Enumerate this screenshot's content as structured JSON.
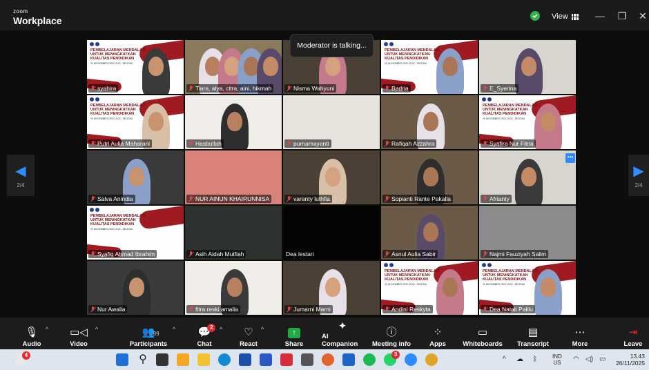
{
  "app": {
    "brand_small": "zoom",
    "brand": "Workplace"
  },
  "titlebar": {
    "view_label": "View",
    "minimize": "—",
    "restore": "❐",
    "close": "✕"
  },
  "toast": "Moderator is talking...",
  "pager": {
    "left": "2/4",
    "right": "2/4"
  },
  "slide": {
    "title": "PEMBELAJARAN MENDALAM UNTUK MENINGKATKAN KUALITAS PENDIDIKAN",
    "date": "20 NOVEMBER 2025 13.00 - SELESAI"
  },
  "participants": [
    {
      "name": "syahira",
      "muted": true,
      "kind": "slide-person"
    },
    {
      "name": "Tiara, alya, citra, aini, hikmah",
      "muted": true,
      "kind": "group"
    },
    {
      "name": "Nisma Wahyuni",
      "muted": true,
      "kind": "person"
    },
    {
      "name": "Badria",
      "muted": true,
      "kind": "slide-person"
    },
    {
      "name": "E_Syerina",
      "muted": true,
      "kind": "person"
    },
    {
      "name": "Putri Aulia Maharani",
      "muted": true,
      "kind": "slide-person"
    },
    {
      "name": "Hasbullah",
      "muted": true,
      "kind": "person"
    },
    {
      "name": "purnamayanti",
      "muted": true,
      "kind": "wall"
    },
    {
      "name": "Rafiqah Azzahra",
      "muted": true,
      "kind": "person"
    },
    {
      "name": "Syafira Nur Fitria",
      "muted": true,
      "kind": "slide-person"
    },
    {
      "name": "Salva Anindia",
      "muted": true,
      "kind": "person"
    },
    {
      "name": "NUR AINUN KHAIRUNNISA",
      "muted": true,
      "kind": "pink"
    },
    {
      "name": "varanty luthfia",
      "muted": true,
      "kind": "person-big"
    },
    {
      "name": "Sopianti Rante Pakalla",
      "muted": true,
      "kind": "person"
    },
    {
      "name": "Afrianty",
      "muted": true,
      "kind": "person"
    },
    {
      "name": "Syafiq Ahmad Ibrahim",
      "muted": true,
      "kind": "slide"
    },
    {
      "name": "Asih Aidah Mutfiah",
      "muted": true,
      "kind": "dark"
    },
    {
      "name": "Dea lestari",
      "muted": false,
      "kind": "black"
    },
    {
      "name": "Asnul Aulia Sabir",
      "muted": true,
      "kind": "person"
    },
    {
      "name": "Najmi Fauziyah Salim",
      "muted": true,
      "kind": "grey"
    },
    {
      "name": "Nur Awalia",
      "muted": true,
      "kind": "person"
    },
    {
      "name": "fitra reski amalia",
      "muted": true,
      "kind": "person"
    },
    {
      "name": "Jumarni Marni",
      "muted": true,
      "kind": "person"
    },
    {
      "name": "Andini Reskyta",
      "muted": true,
      "kind": "slide-person"
    },
    {
      "name": "Dea Natali Palilu",
      "muted": true,
      "kind": "slide-person"
    }
  ],
  "toolbar": {
    "audio": "Audio",
    "video": "Video",
    "participants": "Participants",
    "participants_count": "99",
    "chat": "Chat",
    "chat_badge": "2",
    "react": "React",
    "share": "Share",
    "ai": "AI Companion",
    "meeting_info": "Meeting info",
    "apps": "Apps",
    "whiteboards": "Whiteboards",
    "transcript": "Transcript",
    "more": "More",
    "leave": "Leave"
  },
  "taskbar": {
    "lang_top": "IND",
    "lang_bottom": "US",
    "time": "13.43",
    "date": "26/11/2025",
    "notif_badge": "4",
    "whatsapp_badge": "3"
  },
  "colors": {
    "accent": "#2d8cff",
    "slide_red": "#9e1b22",
    "share_green": "#23a846",
    "mute_red": "#e04848"
  }
}
